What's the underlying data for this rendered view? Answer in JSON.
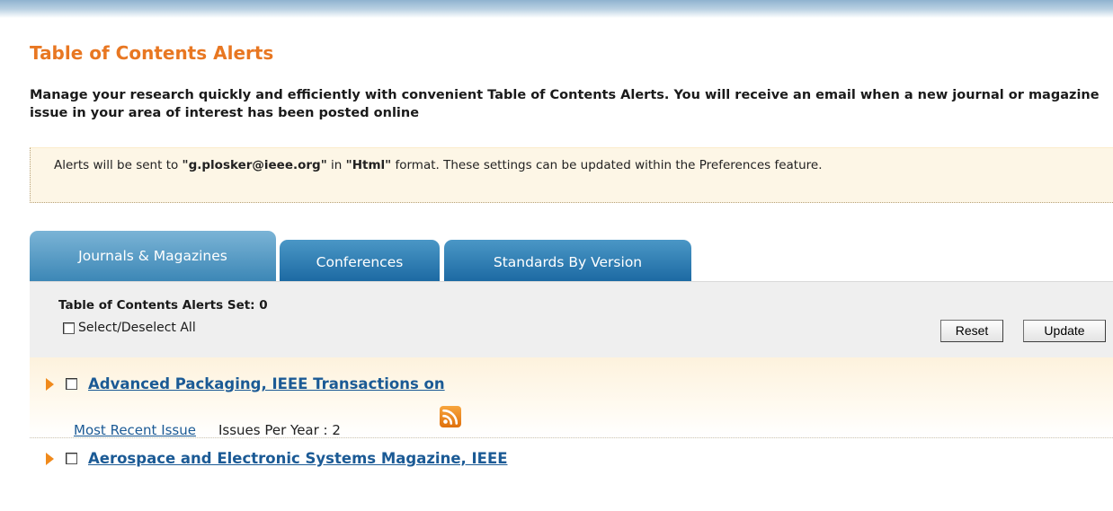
{
  "page": {
    "title": "Table of Contents Alerts",
    "intro": "Manage your research quickly and efficiently with convenient Table of Contents Alerts. You will receive an email when a new journal or magazine issue in your area of interest has been posted online"
  },
  "notice": {
    "prefix": "Alerts will be sent to ",
    "email": "\"g.plosker@ieee.org\"",
    "middle": " in ",
    "format": "\"Html\"",
    "suffix": " format. These settings can be updated within the Preferences feature."
  },
  "tabs": [
    {
      "label": "Journals & Magazines",
      "active": true
    },
    {
      "label": "Conferences",
      "active": false
    },
    {
      "label": "Standards By Version",
      "active": false
    }
  ],
  "panel": {
    "set_count_label": "Table of Contents Alerts Set: 0",
    "select_all_label": "Select/Deselect All",
    "reset_label": "Reset",
    "update_label": "Update"
  },
  "publications": [
    {
      "title": "Advanced Packaging, IEEE Transactions on",
      "recent_label": "Most Recent Issue",
      "issues_label": "Issues Per Year : ",
      "issues_per_year": "2",
      "icon": "rss-icon",
      "expanded": true
    },
    {
      "title": "Aerospace and Electronic Systems Magazine, IEEE",
      "expanded": false
    }
  ],
  "colors": {
    "title": "#e87722",
    "link": "#1b5a95",
    "tab_active": "#3c87b6",
    "tab_inactive": "#1d6aa3",
    "notice_bg": "#fdf6e6",
    "arrow": "#f08a1c",
    "rss": "#f08a1c"
  }
}
